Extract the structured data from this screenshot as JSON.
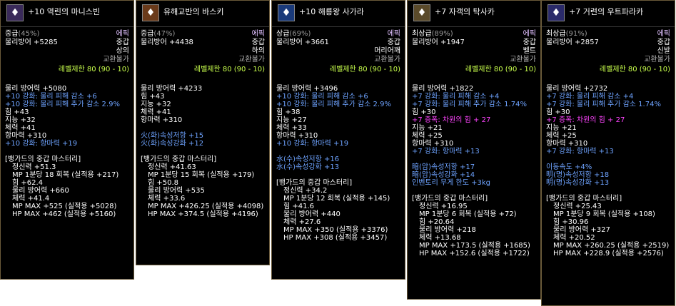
{
  "tooltips": [
    {
      "icon": "armor-icon",
      "name": "+10 역린의 마니스빈",
      "grade": "중급",
      "grade_pct": "(45%)",
      "rarity": "에픽",
      "defense": "물리방어 +5285",
      "armor_type": "중갑",
      "slot": "상의",
      "trade": "교환불가",
      "level_limit": "레벨제한 80 (90 - 10)",
      "stats": [
        {
          "text": "물리 방어력 +5080",
          "color": "white"
        },
        {
          "text": "+10 강화: 물리 피해 감소 +6",
          "color": "blue"
        },
        {
          "text": "+10 강화: 물리 피해 추가 감소 2.9%",
          "color": "blue"
        },
        {
          "text": "힘 +43",
          "color": "white"
        },
        {
          "text": "지능 +32",
          "color": "white"
        },
        {
          "text": "체력 +41",
          "color": "white"
        },
        {
          "text": "항마력 +310",
          "color": "white"
        },
        {
          "text": "+10 강화: 항마력 +19",
          "color": "blue"
        }
      ],
      "mastery_title": "[뱅가드의 중갑 마스터리]",
      "mastery": [
        "정신력 +51.3",
        "MP 1분당 18 회복 (실적용 +217)",
        "힘 +62.4",
        "물리 방어력 +660",
        "체력 +41.4",
        "MP MAX +525 (실적용 +5028)",
        "HP MAX +462 (실적용 +5160)"
      ]
    },
    {
      "icon": "armor-icon",
      "name": "유해교반의 바스키",
      "grade": "중급",
      "grade_pct": "(47%)",
      "rarity": "에픽",
      "defense": "물리방어 +4438",
      "armor_type": "중갑",
      "slot": "하의",
      "trade": "교환불가",
      "level_limit": "레벨제한 80 (90 - 10)",
      "stats": [
        {
          "text": "물리 방어력 +4233",
          "color": "white"
        },
        {
          "text": "힘 +43",
          "color": "white"
        },
        {
          "text": "지능 +32",
          "color": "white"
        },
        {
          "text": "체력 +41",
          "color": "white"
        },
        {
          "text": "항마력 +310",
          "color": "white"
        },
        {
          "text": "",
          "color": "white"
        },
        {
          "text": "火(화)속성저항 +15",
          "color": "blue"
        },
        {
          "text": "火(화)속성강화 +12",
          "color": "blue"
        }
      ],
      "mastery_title": "[뱅가드의 중갑 마스터리]",
      "mastery": [
        "정신력 +41.63",
        "MP 1분당 15 회복 (실적용 +179)",
        "힘 +50.8",
        "물리 방어력 +535",
        "체력 +33.6",
        "MP MAX +426.25 (실적용 +4098)",
        "HP MAX +374.5 (실적용 +4196)"
      ]
    },
    {
      "icon": "armor-icon",
      "name": "+10 해룡왕 사가라",
      "grade": "상급",
      "grade_pct": "(69%)",
      "rarity": "에픽",
      "defense": "물리방어 +3661",
      "armor_type": "중갑",
      "slot": "머리어깨",
      "trade": "교환불가",
      "level_limit": "레벨제한 80 (90 - 10)",
      "stats": [
        {
          "text": "물리 방어력 +3496",
          "color": "white"
        },
        {
          "text": "+10 강화: 물리 피해 감소 +6",
          "color": "blue"
        },
        {
          "text": "+10 강화: 물리 피해 추가 감소 2.9%",
          "color": "blue"
        },
        {
          "text": "힘 +38",
          "color": "white"
        },
        {
          "text": "지능 +27",
          "color": "white"
        },
        {
          "text": "체력 +33",
          "color": "white"
        },
        {
          "text": "항마력 +310",
          "color": "white"
        },
        {
          "text": "+10 강화: 항마력 +19",
          "color": "blue"
        },
        {
          "text": "",
          "color": "white"
        },
        {
          "text": "水(수)속성저항 +16",
          "color": "blue"
        },
        {
          "text": "水(수)속성강화 +13",
          "color": "blue"
        }
      ],
      "mastery_title": "[뱅가드의 중갑 마스터리]",
      "mastery": [
        "정신력 +34.2",
        "MP 1분당 12 회복 (실적용 +145)",
        "힘 +41.6",
        "물리 방어력 +440",
        "체력 +27.6",
        "MP MAX +350 (실적용 +3376)",
        "HP MAX +308 (실적용 +3457)"
      ]
    },
    {
      "icon": "armor-icon",
      "name": "+7 자객의 탁사카",
      "grade": "최상급",
      "grade_pct": "(89%)",
      "rarity": "에픽",
      "defense": "물리방어 +1947",
      "armor_type": "중갑",
      "slot": "벨트",
      "trade": "교환불가",
      "level_limit": "레벨제한 80 (90 - 10)",
      "stats": [
        {
          "text": "물리 방어력 +1822",
          "color": "white"
        },
        {
          "text": "+7 강화: 물리 피해 감소 +4",
          "color": "blue"
        },
        {
          "text": "+7 강화: 물리 피해 추가 감소 1.74%",
          "color": "blue"
        },
        {
          "text": "힘 +30",
          "color": "white"
        },
        {
          "text": "+7 증폭: 차원의 힘 + 27",
          "color": "pink"
        },
        {
          "text": "지능 +21",
          "color": "white"
        },
        {
          "text": "체력 +25",
          "color": "white"
        },
        {
          "text": "항마력 +310",
          "color": "white"
        },
        {
          "text": "+7 강화: 항마력 +13",
          "color": "blue"
        },
        {
          "text": "",
          "color": "white"
        },
        {
          "text": "暗(암)속성저항 +17",
          "color": "blue"
        },
        {
          "text": "暗(암)속성강화 +14",
          "color": "blue"
        },
        {
          "text": "인벤토리 무게 한도 +3kg",
          "color": "blue"
        }
      ],
      "mastery_title": "[뱅가드의 중갑 마스터리]",
      "mastery": [
        "정신력 +16.95",
        "MP 1분당 6 회복 (실적용 +72)",
        "힘 +20.64",
        "물리 방어력 +218",
        "체력 +13.68",
        "MP MAX +173.5 (실적용 +1685)",
        "HP MAX +152.6 (실적용 +1722)"
      ]
    },
    {
      "icon": "armor-icon",
      "name": "+7 거련의 우트파라카",
      "grade": "최상급",
      "grade_pct": "(91%)",
      "rarity": "에픽",
      "defense": "물리방어 +2857",
      "armor_type": "중갑",
      "slot": "신발",
      "trade": "교환불가",
      "level_limit": "레벨제한 80 (90 - 10)",
      "stats": [
        {
          "text": "물리 방어력 +2732",
          "color": "white"
        },
        {
          "text": "+7 강화: 물리 피해 감소 +4",
          "color": "blue"
        },
        {
          "text": "+7 강화: 물리 피해 추가 감소 1.74%",
          "color": "blue"
        },
        {
          "text": "힘 +30",
          "color": "white"
        },
        {
          "text": "+7 증폭: 차원의 힘 + 27",
          "color": "pink"
        },
        {
          "text": "지능 +21",
          "color": "white"
        },
        {
          "text": "체력 +25",
          "color": "white"
        },
        {
          "text": "항마력 +310",
          "color": "white"
        },
        {
          "text": "+7 강화: 항마력 +13",
          "color": "blue"
        },
        {
          "text": "",
          "color": "white"
        },
        {
          "text": "이동속도 +4%",
          "color": "blue"
        },
        {
          "text": "明(명)속성저항 +18",
          "color": "blue"
        },
        {
          "text": "明(명)속성강화 +13",
          "color": "blue"
        }
      ],
      "mastery_title": "[뱅가드의 중갑 마스터리]",
      "mastery": [
        "정신력 +25.43",
        "MP 1분당 9 회복 (실적용 +108)",
        "힘 +30.96",
        "물리 방어력 +327",
        "체력 +20.52",
        "MP MAX +260.25 (실적용 +2519)",
        "HP MAX +228.9 (실적용 +2576)"
      ]
    }
  ],
  "colors": {
    "white": "#ffffff",
    "blue": "#6ea3ff",
    "pink": "#ff44ff",
    "level": "#c8ff4c",
    "rarity": "#e0c0ff"
  }
}
